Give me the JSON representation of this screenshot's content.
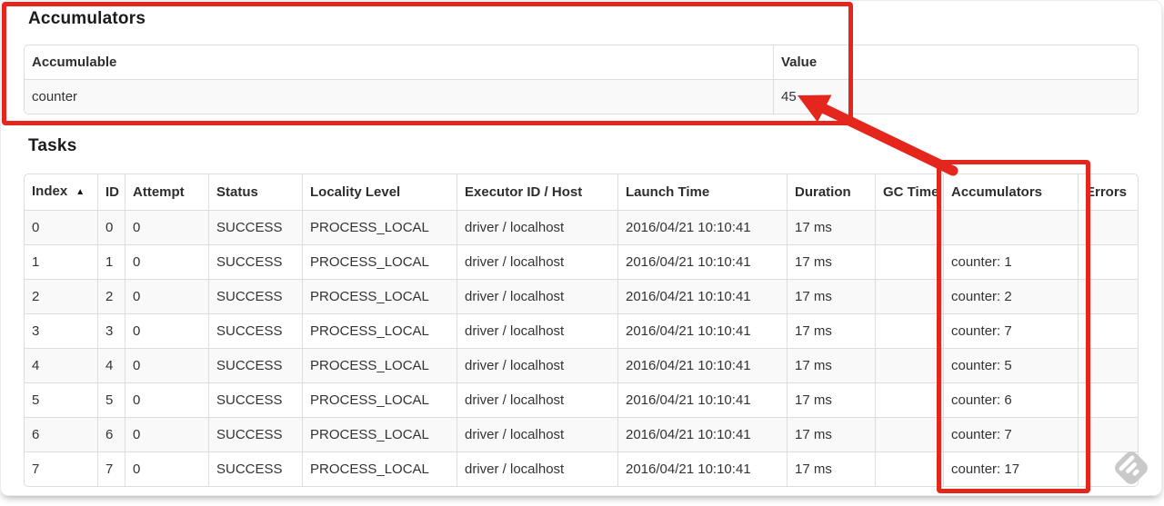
{
  "accumulators_section": {
    "heading": "Accumulators",
    "columns": [
      "Accumulable",
      "Value"
    ],
    "rows": [
      {
        "accumulable": "counter",
        "value": "45"
      }
    ]
  },
  "tasks_section": {
    "heading": "Tasks",
    "sort_ascending_icon": "▲",
    "columns": [
      {
        "key": "index",
        "label": "Index",
        "sorted": "asc"
      },
      {
        "key": "id",
        "label": "ID"
      },
      {
        "key": "attempt",
        "label": "Attempt"
      },
      {
        "key": "status",
        "label": "Status"
      },
      {
        "key": "locality",
        "label": "Locality Level"
      },
      {
        "key": "executor",
        "label": "Executor ID / Host"
      },
      {
        "key": "launch",
        "label": "Launch Time"
      },
      {
        "key": "duration",
        "label": "Duration"
      },
      {
        "key": "gc",
        "label": "GC Time"
      },
      {
        "key": "accumulators",
        "label": "Accumulators"
      },
      {
        "key": "errors",
        "label": "Errors"
      }
    ],
    "rows": [
      {
        "index": "0",
        "id": "0",
        "attempt": "0",
        "status": "SUCCESS",
        "locality": "PROCESS_LOCAL",
        "executor": "driver / localhost",
        "launch": "2016/04/21 10:10:41",
        "duration": "17 ms",
        "gc": "",
        "accumulators": "",
        "errors": ""
      },
      {
        "index": "1",
        "id": "1",
        "attempt": "0",
        "status": "SUCCESS",
        "locality": "PROCESS_LOCAL",
        "executor": "driver / localhost",
        "launch": "2016/04/21 10:10:41",
        "duration": "17 ms",
        "gc": "",
        "accumulators": "counter: 1",
        "errors": ""
      },
      {
        "index": "2",
        "id": "2",
        "attempt": "0",
        "status": "SUCCESS",
        "locality": "PROCESS_LOCAL",
        "executor": "driver / localhost",
        "launch": "2016/04/21 10:10:41",
        "duration": "17 ms",
        "gc": "",
        "accumulators": "counter: 2",
        "errors": ""
      },
      {
        "index": "3",
        "id": "3",
        "attempt": "0",
        "status": "SUCCESS",
        "locality": "PROCESS_LOCAL",
        "executor": "driver / localhost",
        "launch": "2016/04/21 10:10:41",
        "duration": "17 ms",
        "gc": "",
        "accumulators": "counter: 7",
        "errors": ""
      },
      {
        "index": "4",
        "id": "4",
        "attempt": "0",
        "status": "SUCCESS",
        "locality": "PROCESS_LOCAL",
        "executor": "driver / localhost",
        "launch": "2016/04/21 10:10:41",
        "duration": "17 ms",
        "gc": "",
        "accumulators": "counter: 5",
        "errors": ""
      },
      {
        "index": "5",
        "id": "5",
        "attempt": "0",
        "status": "SUCCESS",
        "locality": "PROCESS_LOCAL",
        "executor": "driver / localhost",
        "launch": "2016/04/21 10:10:41",
        "duration": "17 ms",
        "gc": "",
        "accumulators": "counter: 6",
        "errors": ""
      },
      {
        "index": "6",
        "id": "6",
        "attempt": "0",
        "status": "SUCCESS",
        "locality": "PROCESS_LOCAL",
        "executor": "driver / localhost",
        "launch": "2016/04/21 10:10:41",
        "duration": "17 ms",
        "gc": "",
        "accumulators": "counter: 7",
        "errors": ""
      },
      {
        "index": "7",
        "id": "7",
        "attempt": "0",
        "status": "SUCCESS",
        "locality": "PROCESS_LOCAL",
        "executor": "driver / localhost",
        "launch": "2016/04/21 10:10:41",
        "duration": "17 ms",
        "gc": "",
        "accumulators": "counter: 17",
        "errors": ""
      }
    ]
  },
  "annotations": {
    "color": "#e5261d"
  },
  "watermark": {
    "icon": "feedly-diamond-icon",
    "color": "#c9c9c9"
  }
}
